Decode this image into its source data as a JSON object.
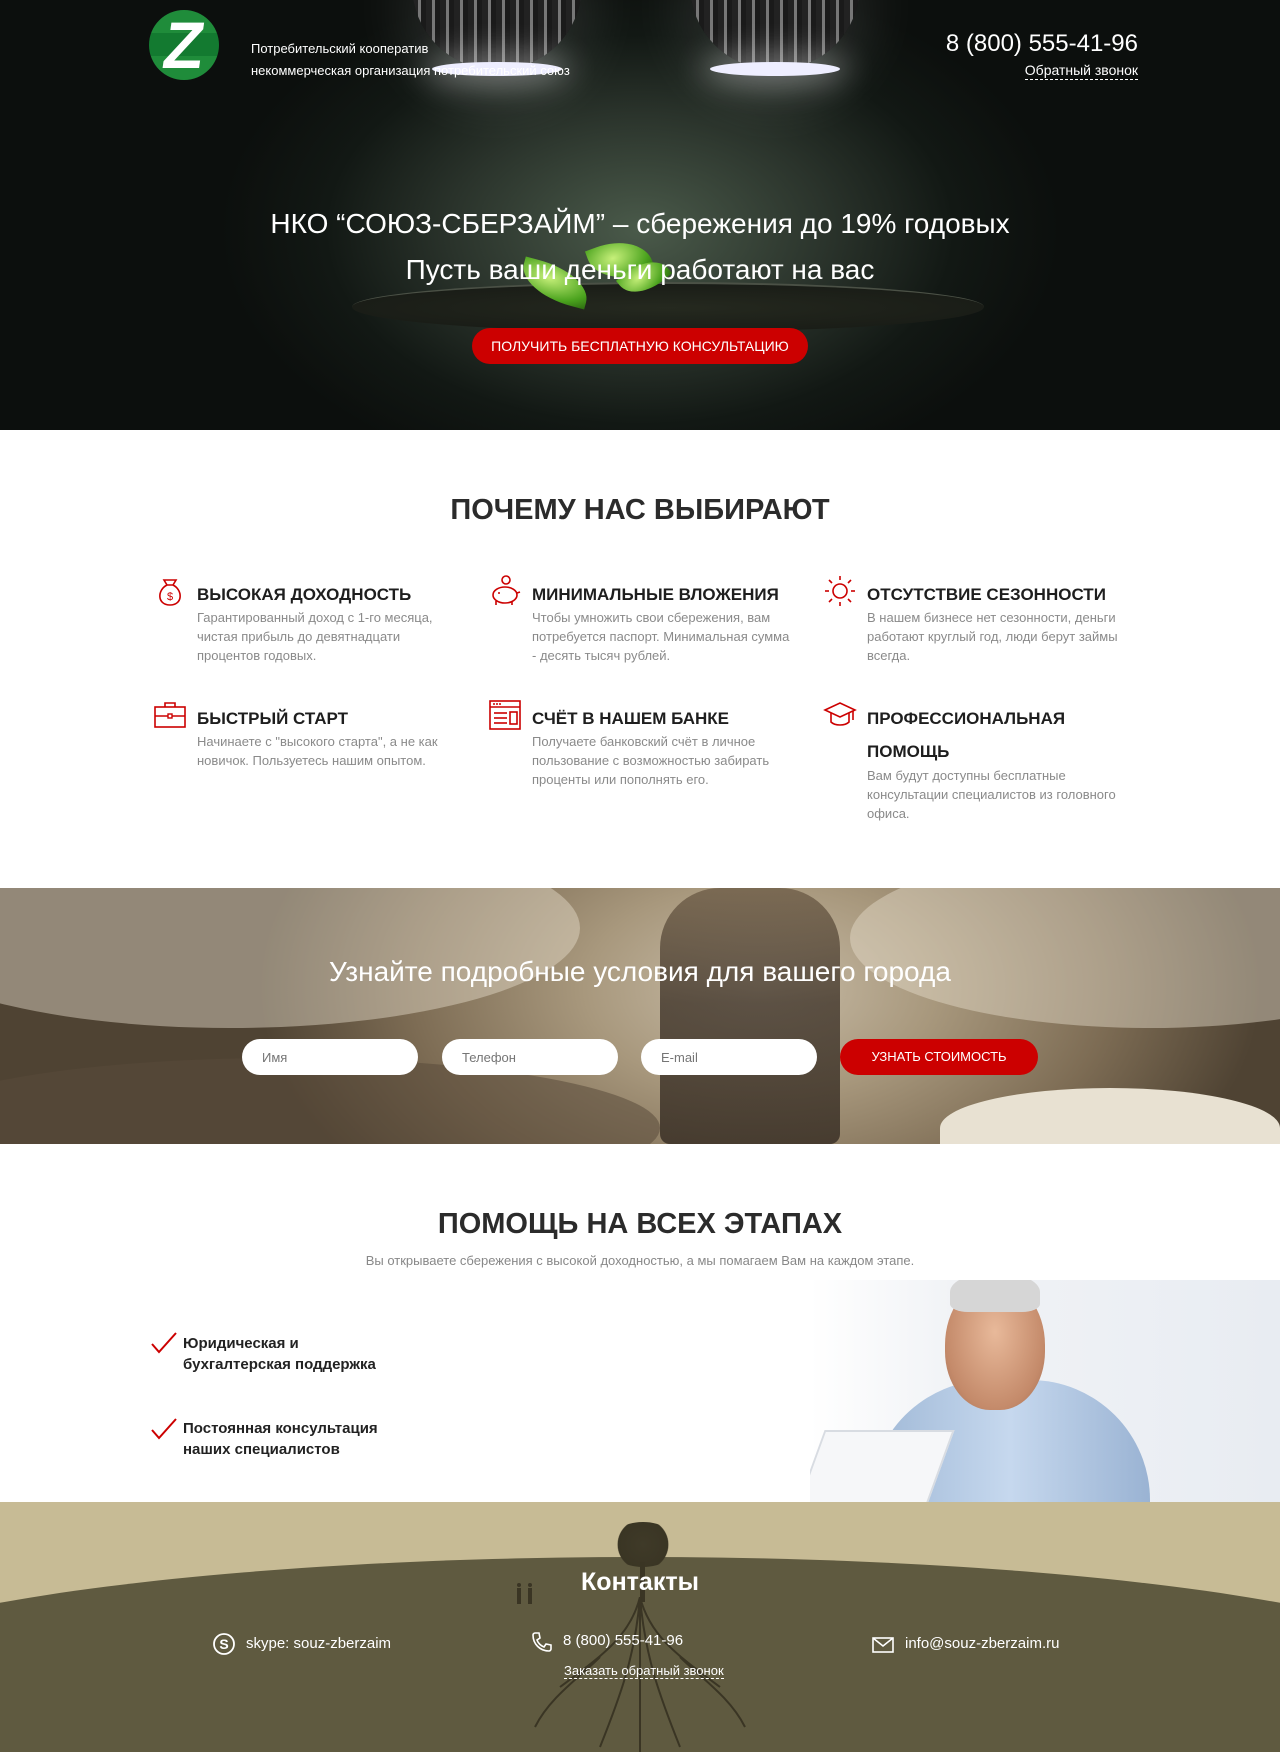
{
  "header": {
    "logo_letter": "Z",
    "tagline_line1": "Потребительский кооператив",
    "tagline_line2": "некоммерческая организация потребительский союз",
    "phone": "8 (800) 555-41-96",
    "callback_label": "Обратный звонок"
  },
  "hero": {
    "title": "НКО “СОЮЗ-СБЕРЗАЙМ” – сбережения до 19% годовых",
    "subtitle": "Пусть ваши деньги работают на вас",
    "cta_label": "ПОЛУЧИТЬ БЕСПЛАТНУЮ КОНСУЛЬТАЦИЮ"
  },
  "why": {
    "title": "ПОЧЕМУ НАС ВЫБИРАЮТ",
    "features": [
      {
        "title": "ВЫСОКАЯ ДОХОДНОСТЬ",
        "text": "Гарантированный доход с 1-го месяца, чистая прибыль до девятнадцати процентов годовых.",
        "icon": "money-bag-icon"
      },
      {
        "title": "МИНИМАЛЬНЫЕ ВЛОЖЕНИЯ",
        "text": "Чтобы умножить свои сбережения, вам потребуется паспорт. Минимальная сумма - десять тысяч рублей.",
        "icon": "piggy-bank-icon"
      },
      {
        "title": "ОТСУТСТВИЕ СЕЗОННОСТИ",
        "text": "В нашем бизнесе нет сезонности, деньги работают круглый год, люди берут займы всегда.",
        "icon": "sun-icon"
      },
      {
        "title": "БЫСТРЫЙ СТАРТ",
        "text": "Начинаете с \"высокого старта\", а не как новичок. Пользуетесь нашим опытом.",
        "icon": "briefcase-icon"
      },
      {
        "title": "СЧЁТ В НАШЕМ БАНКЕ",
        "text": "Получаете банковский счёт в личное пользование с возможностью забирать проценты или пополнять его.",
        "icon": "bank-window-icon"
      },
      {
        "title": "ПРОФЕССИОНАЛЬНАЯ ПОМОЩЬ",
        "text": "Вам будут доступны бесплатные консультации специалистов из головного офиса.",
        "icon": "graduation-cap-icon"
      }
    ]
  },
  "cta_band": {
    "title": "Узнайте подробные условия для вашего города",
    "name_placeholder": "Имя",
    "phone_placeholder": "Телефон",
    "email_placeholder": "E-mail",
    "submit_label": "УЗНАТЬ СТОИМОСТЬ"
  },
  "help": {
    "title": "ПОМОЩЬ НА ВСЕХ ЭТАПАХ",
    "subtitle": "Вы открываете сбережения с высокой доходностью, а мы помагаем Вам на каждом этапе.",
    "items": [
      {
        "line1": "Юридическая и",
        "line2": "бухгалтерская поддержка"
      },
      {
        "line1": "Постоянная консультация",
        "line2": "наших специалистов"
      }
    ]
  },
  "footer": {
    "title": "Контакты",
    "skype": "skype: souz-zberzaim",
    "phone": "8 (800) 555-41-96",
    "callback_label": "Заказать обратный звонок",
    "email": "info@souz-zberzaim.ru"
  },
  "colors": {
    "accent_red": "#cc0000",
    "logo_green": "#1f8c3a",
    "footer_olive": "#5f5a40",
    "footer_sky": "#c7bb95"
  }
}
